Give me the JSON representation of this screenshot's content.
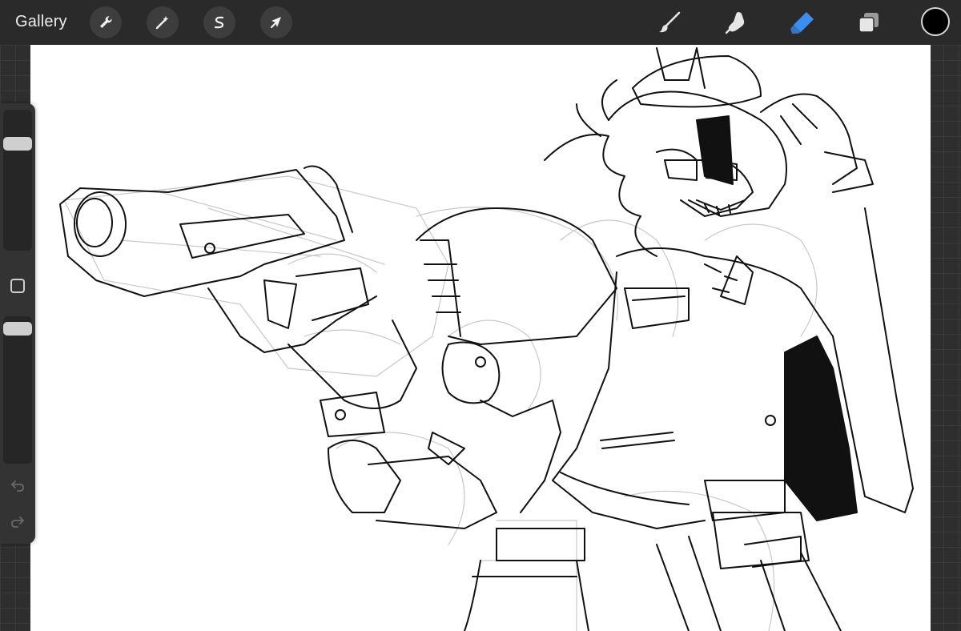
{
  "topbar": {
    "gallery_label": "Gallery",
    "left_tools": [
      {
        "name": "actions",
        "icon": "wrench-icon"
      },
      {
        "name": "adjustments",
        "icon": "magic-wand-icon"
      },
      {
        "name": "selection",
        "icon": "selection-s-icon"
      },
      {
        "name": "transform",
        "icon": "arrow-cursor-icon"
      }
    ],
    "right_tools": [
      {
        "name": "brush",
        "icon": "brush-icon"
      },
      {
        "name": "smudge",
        "icon": "smudge-finger-icon"
      },
      {
        "name": "eraser",
        "icon": "eraser-icon",
        "active": true
      },
      {
        "name": "layers",
        "icon": "layers-icon"
      }
    ],
    "current_color": "#000000",
    "active_color": "#3a8ff0"
  },
  "sidebar": {
    "brush_size_icon": "size-slider",
    "opacity_icon": "opacity-slider",
    "modify_icon": "square-modify-icon",
    "undo_icon": "undo-arrow-icon",
    "redo_icon": "redo-arrow-icon"
  },
  "canvas": {
    "background": "#ffffff",
    "content": "line-art-sketch"
  }
}
